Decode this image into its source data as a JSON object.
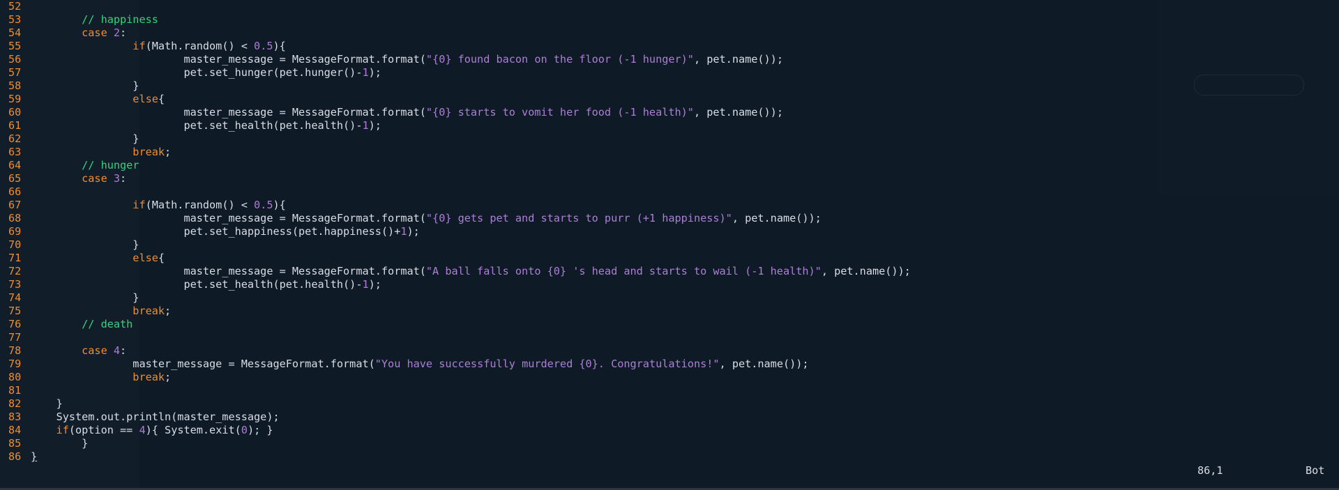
{
  "editor": {
    "lines": [
      {
        "n": "52",
        "tokens": []
      },
      {
        "n": "53",
        "tokens": [
          {
            "t": "cm",
            "v": "        // happiness"
          }
        ]
      },
      {
        "n": "54",
        "tokens": [
          {
            "t": "kw",
            "v": "        case "
          },
          {
            "t": "num",
            "v": "2"
          },
          {
            "t": "plain",
            "v": ":"
          }
        ]
      },
      {
        "n": "55",
        "tokens": [
          {
            "t": "kw",
            "v": "                if"
          },
          {
            "t": "plain",
            "v": "(Math.random() < "
          },
          {
            "t": "num",
            "v": "0.5"
          },
          {
            "t": "plain",
            "v": "){"
          }
        ]
      },
      {
        "n": "56",
        "tokens": [
          {
            "t": "plain",
            "v": "                        master_message = MessageFormat.format("
          },
          {
            "t": "str",
            "v": "\"{0} found bacon on the floor (-1 hunger)\""
          },
          {
            "t": "plain",
            "v": ", pet.name());"
          }
        ]
      },
      {
        "n": "57",
        "tokens": [
          {
            "t": "plain",
            "v": "                        pet.set_hunger(pet.hunger()-"
          },
          {
            "t": "num",
            "v": "1"
          },
          {
            "t": "plain",
            "v": ");"
          }
        ]
      },
      {
        "n": "58",
        "tokens": [
          {
            "t": "plain",
            "v": "                }"
          }
        ]
      },
      {
        "n": "59",
        "tokens": [
          {
            "t": "kw",
            "v": "                else"
          },
          {
            "t": "plain",
            "v": "{"
          }
        ]
      },
      {
        "n": "60",
        "tokens": [
          {
            "t": "plain",
            "v": "                        master_message = MessageFormat.format("
          },
          {
            "t": "str",
            "v": "\"{0} starts to vomit her food (-1 health)\""
          },
          {
            "t": "plain",
            "v": ", pet.name());"
          }
        ]
      },
      {
        "n": "61",
        "tokens": [
          {
            "t": "plain",
            "v": "                        pet.set_health(pet.health()-"
          },
          {
            "t": "num",
            "v": "1"
          },
          {
            "t": "plain",
            "v": ");"
          }
        ]
      },
      {
        "n": "62",
        "tokens": [
          {
            "t": "plain",
            "v": "                }"
          }
        ]
      },
      {
        "n": "63",
        "tokens": [
          {
            "t": "kw",
            "v": "                break"
          },
          {
            "t": "plain",
            "v": ";"
          }
        ]
      },
      {
        "n": "64",
        "tokens": [
          {
            "t": "cm",
            "v": "        // hunger"
          }
        ]
      },
      {
        "n": "65",
        "tokens": [
          {
            "t": "kw",
            "v": "        case "
          },
          {
            "t": "num",
            "v": "3"
          },
          {
            "t": "plain",
            "v": ":"
          }
        ]
      },
      {
        "n": "66",
        "tokens": []
      },
      {
        "n": "67",
        "tokens": [
          {
            "t": "kw",
            "v": "                if"
          },
          {
            "t": "plain",
            "v": "(Math.random() < "
          },
          {
            "t": "num",
            "v": "0.5"
          },
          {
            "t": "plain",
            "v": "){"
          }
        ]
      },
      {
        "n": "68",
        "tokens": [
          {
            "t": "plain",
            "v": "                        master_message = MessageFormat.format("
          },
          {
            "t": "str",
            "v": "\"{0} gets pet and starts to purr (+1 happiness)\""
          },
          {
            "t": "plain",
            "v": ", pet.name());"
          }
        ]
      },
      {
        "n": "69",
        "tokens": [
          {
            "t": "plain",
            "v": "                        pet.set_happiness(pet.happiness()+"
          },
          {
            "t": "num",
            "v": "1"
          },
          {
            "t": "plain",
            "v": ");"
          }
        ]
      },
      {
        "n": "70",
        "tokens": [
          {
            "t": "plain",
            "v": "                }"
          }
        ]
      },
      {
        "n": "71",
        "tokens": [
          {
            "t": "kw",
            "v": "                else"
          },
          {
            "t": "plain",
            "v": "{"
          }
        ]
      },
      {
        "n": "72",
        "tokens": [
          {
            "t": "plain",
            "v": "                        master_message = MessageFormat.format("
          },
          {
            "t": "str",
            "v": "\"A ball falls onto {0} 's head and starts to wail (-1 health)\""
          },
          {
            "t": "plain",
            "v": ", pet.name());"
          }
        ]
      },
      {
        "n": "73",
        "tokens": [
          {
            "t": "plain",
            "v": "                        pet.set_health(pet.health()-"
          },
          {
            "t": "num",
            "v": "1"
          },
          {
            "t": "plain",
            "v": ");"
          }
        ]
      },
      {
        "n": "74",
        "tokens": [
          {
            "t": "plain",
            "v": "                }"
          }
        ]
      },
      {
        "n": "75",
        "tokens": [
          {
            "t": "kw",
            "v": "                break"
          },
          {
            "t": "plain",
            "v": ";"
          }
        ]
      },
      {
        "n": "76",
        "tokens": [
          {
            "t": "cm",
            "v": "        // death"
          }
        ]
      },
      {
        "n": "77",
        "tokens": []
      },
      {
        "n": "78",
        "tokens": [
          {
            "t": "kw",
            "v": "        case "
          },
          {
            "t": "num",
            "v": "4"
          },
          {
            "t": "plain",
            "v": ":"
          }
        ]
      },
      {
        "n": "79",
        "tokens": [
          {
            "t": "plain",
            "v": "                master_message = MessageFormat.format("
          },
          {
            "t": "str",
            "v": "\"You have successfully murdered {0}. Congratulations!\""
          },
          {
            "t": "plain",
            "v": ", pet.name());"
          }
        ]
      },
      {
        "n": "80",
        "tokens": [
          {
            "t": "kw",
            "v": "                break"
          },
          {
            "t": "plain",
            "v": ";"
          }
        ]
      },
      {
        "n": "81",
        "tokens": []
      },
      {
        "n": "82",
        "tokens": [
          {
            "t": "plain",
            "v": "    }"
          }
        ]
      },
      {
        "n": "83",
        "tokens": [
          {
            "t": "plain",
            "v": "    System.out.println(master_message);"
          }
        ]
      },
      {
        "n": "84",
        "tokens": [
          {
            "t": "kw",
            "v": "    if"
          },
          {
            "t": "plain",
            "v": "(option == "
          },
          {
            "t": "num",
            "v": "4"
          },
          {
            "t": "plain",
            "v": "){ System.exit("
          },
          {
            "t": "num",
            "v": "0"
          },
          {
            "t": "plain",
            "v": "); }"
          }
        ]
      },
      {
        "n": "85",
        "tokens": [
          {
            "t": "plain",
            "v": "        }"
          }
        ]
      },
      {
        "n": "86",
        "tokens": [
          {
            "t": "cursor",
            "v": "}"
          }
        ]
      }
    ]
  },
  "status": {
    "position": "86,1",
    "scroll": "Bot"
  },
  "colors": {
    "background": "#0e1a26",
    "keyword": "#f08d2e",
    "line_number": "#f08d2e",
    "string": "#ad7fd6",
    "number": "#b17ad6",
    "comment": "#39d37b",
    "text": "#d8dde6"
  }
}
